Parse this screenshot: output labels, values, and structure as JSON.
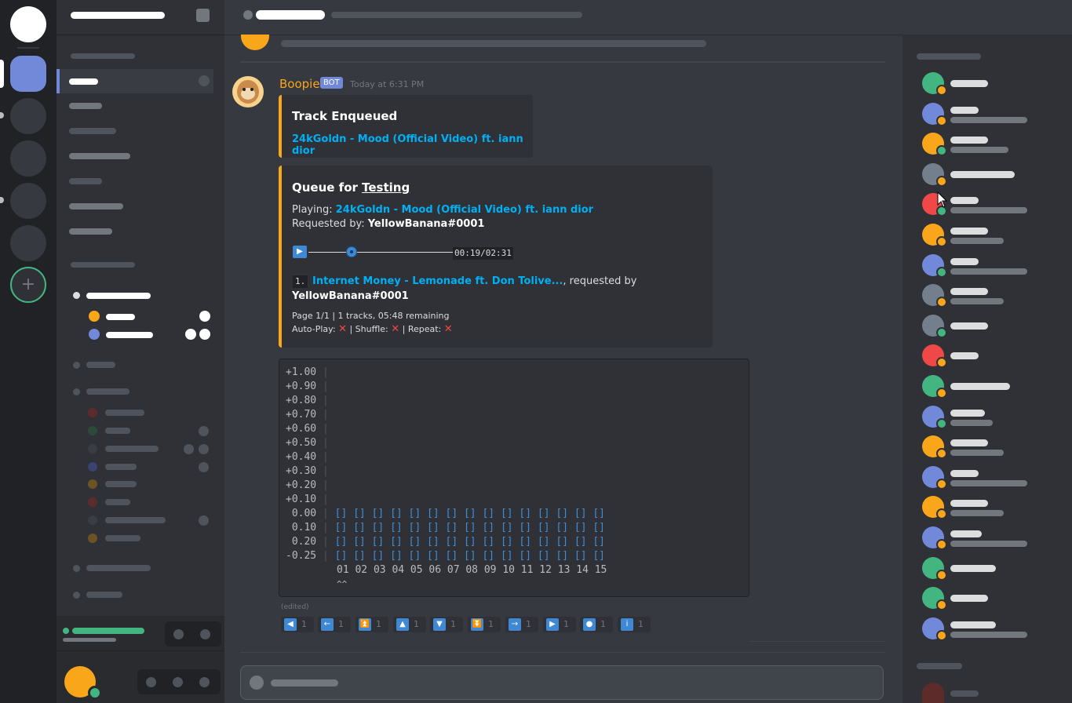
{
  "message": {
    "author": "Boopie",
    "bot_tag": "BOT",
    "timestamp": "Today at 6:31 PM",
    "edited_label": "(edited)"
  },
  "embed1": {
    "title": "Track Enqueued",
    "track_link": "24kGoldn - Mood (Official Video) ft. iann dior"
  },
  "embed2": {
    "title_prefix": "Queue for ",
    "title_channel": "Testing",
    "playing_label": "Playing: ",
    "playing_track": "24kGoldn - Mood (Official Video) ft. iann dior",
    "requested_label": "Requested by: ",
    "requester": "YellowBanana#0001",
    "time_current": "00:19",
    "time_sep": "/",
    "time_total": "02:31",
    "progress": 0.3,
    "queue_index": "1.",
    "queue_track": "Internet Money - Lemonade ft. Don Tolive...",
    "queue_requested": ", requested by",
    "queue_requester": "YellowBanana#0001",
    "footer_page": "Page 1/1 | 1 tracks, 05:48 remaining",
    "autoplay_label": "Auto-Play:",
    "shuffle_label": "| Shuffle:",
    "repeat_label": "| Repeat:"
  },
  "code": {
    "y_labels": [
      "+1.00",
      "+0.90",
      "+0.80",
      "+0.70",
      "+0.60",
      "+0.50",
      "+0.40",
      "+0.30",
      "+0.20",
      "+0.10",
      " 0.00",
      " 0.10",
      " 0.20",
      "-0.25"
    ],
    "row_cells": "[] [] [] [] [] [] [] [] [] [] [] [] [] [] []",
    "x_labels": "01 02 03 04 05 06 07 08 09 10 11 12 13 14 15",
    "caret": "^^"
  },
  "reactions": [
    {
      "icon": "◀",
      "count": "1",
      "name": "previous-icon"
    },
    {
      "icon": "←",
      "count": "1",
      "name": "arrow-left-icon"
    },
    {
      "icon": "⏫",
      "count": "1",
      "name": "double-up-icon"
    },
    {
      "icon": "▲",
      "count": "1",
      "name": "up-icon"
    },
    {
      "icon": "▼",
      "count": "1",
      "name": "down-icon"
    },
    {
      "icon": "⏬",
      "count": "1",
      "name": "double-down-icon"
    },
    {
      "icon": "→",
      "count": "1",
      "name": "arrow-right-icon"
    },
    {
      "icon": "▶",
      "count": "1",
      "name": "next-icon"
    },
    {
      "icon": "●",
      "count": "1",
      "name": "record-icon"
    },
    {
      "icon": "i",
      "count": "1",
      "name": "info-icon"
    }
  ],
  "colors": {
    "accent_gold": "#faa61a",
    "link_blue": "#00b0f4",
    "bot_tag": "#7289da",
    "online": "#43b581",
    "idle": "#faa61a",
    "dnd": "#f04747"
  }
}
